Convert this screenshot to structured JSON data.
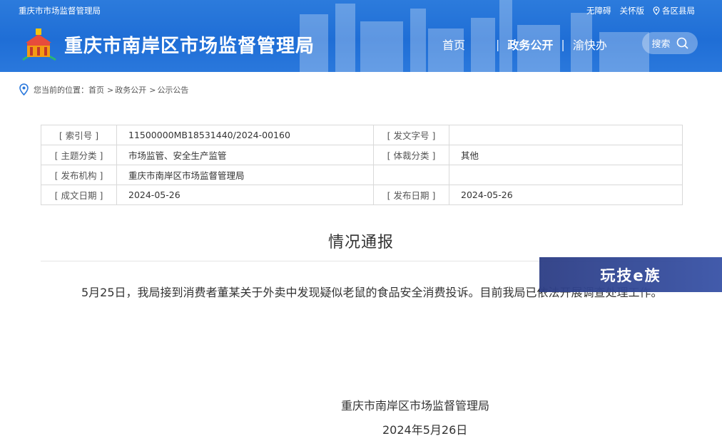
{
  "header": {
    "topbar_left": "重庆市市场监督管理局",
    "accessibility": "无障碍",
    "care_mode": "关怀版",
    "district_site": "各区县局",
    "site_title": "重庆市南岸区市场监督管理局",
    "nav": {
      "home": "首页",
      "gov_open": "政务公开",
      "yukuaiban": "渝快办"
    },
    "search_label": "搜索",
    "colors": {
      "header_blue": "#1f6ed6"
    }
  },
  "breadcrumb": {
    "prefix": "您当前的位置：",
    "items": [
      "首页",
      "政务公开",
      "公示公告"
    ]
  },
  "meta": {
    "index_no_label": "[ 索引号 ]",
    "index_no": "11500000MB18531440/2024-00160",
    "doc_no_label": "[ 发文字号 ]",
    "doc_no": "",
    "topic_label": "[ 主题分类 ]",
    "topic": "市场监管、安全生产监管",
    "genre_label": "[ 体裁分类 ]",
    "genre": "其他",
    "publisher_label": "[ 发布机构 ]",
    "publisher": "重庆市南岸区市场监督管理局",
    "created_label": "[ 成文日期 ]",
    "created": "2024-05-26",
    "published_label": "[ 发布日期 ]",
    "published": "2024-05-26"
  },
  "article": {
    "title": "情况通报",
    "body": "5月25日，我局接到消费者董某关于外卖中发现疑似老鼠的食品安全消费投诉。目前我局已依法开展调查处理工作。",
    "sign_org": "重庆市南岸区市场监督管理局",
    "sign_date": "2024年5月26日"
  },
  "watermark": "玩技e族"
}
